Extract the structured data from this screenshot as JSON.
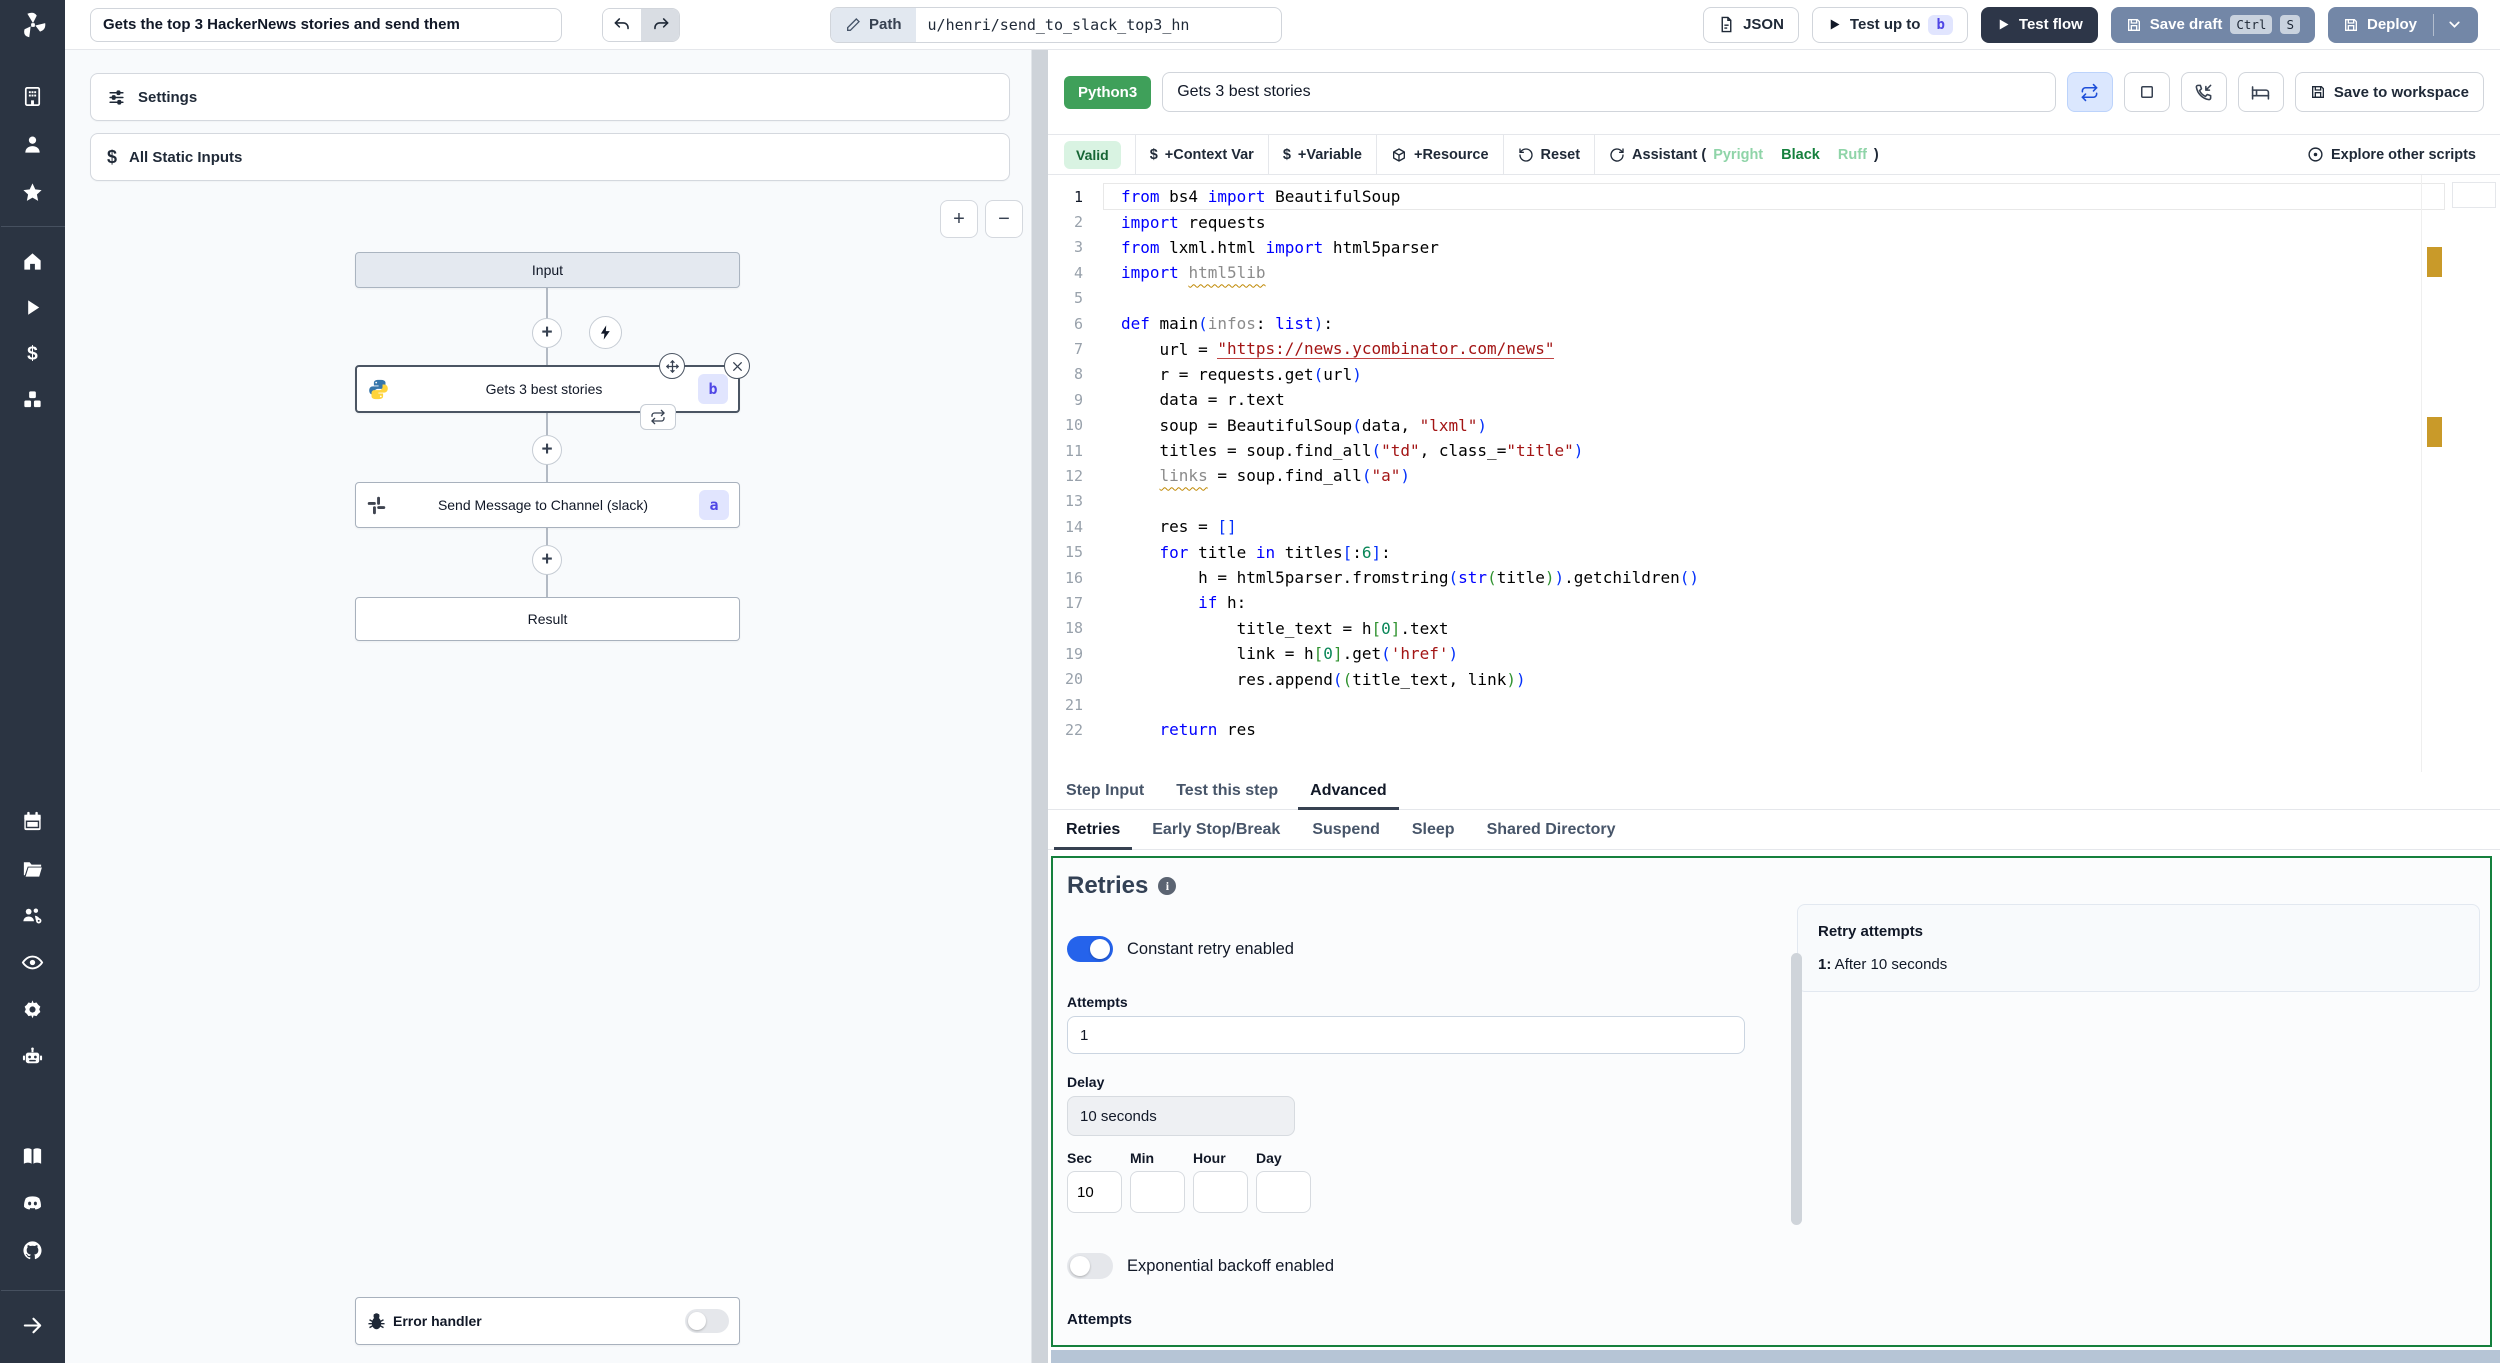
{
  "topbar": {
    "flow_title": "Gets the top 3 HackerNews stories and send them",
    "path_label": "Path",
    "path_value": "u/henri/send_to_slack_top3_hn",
    "json_button": "JSON",
    "test_up_to": "Test up to",
    "test_up_to_badge": "b",
    "test_flow": "Test flow",
    "save_draft": "Save draft",
    "kbd_ctrl": "Ctrl",
    "kbd_s": "S",
    "deploy": "Deploy"
  },
  "sidebar": {
    "icons": [
      "windmill-logo",
      "workspace-building",
      "user",
      "favorites-star",
      "home",
      "runs-play",
      "variables-dollar",
      "resources-cubes",
      "schedules-calendar",
      "folders",
      "groups-users",
      "audit-eye",
      "settings-gear",
      "workers-robot",
      "docs-book",
      "discord",
      "github",
      "expand-arrow"
    ]
  },
  "flow_panel": {
    "settings_label": "Settings",
    "static_inputs_label": "All Static Inputs",
    "zoom_in": "+",
    "zoom_out": "−",
    "nodes": {
      "input": "Input",
      "step_b_label": "Gets 3 best stories",
      "step_b_badge": "b",
      "step_a_label": "Send Message to Channel (slack)",
      "step_a_badge": "a",
      "result": "Result"
    },
    "error_handler_label": "Error handler"
  },
  "editor": {
    "language_badge": "Python3",
    "step_name": "Gets 3 best stories",
    "save_to_workspace": "Save to workspace",
    "toolbar": {
      "valid": "Valid",
      "context_var": "+Context Var",
      "variable": "+Variable",
      "resource": "+Resource",
      "reset": "Reset",
      "assistant_prefix": "Assistant (",
      "assistant_pyright": "Pyright",
      "assistant_black": "Black",
      "assistant_ruff": "Ruff",
      "assistant_suffix": ")",
      "explore": "Explore other scripts"
    },
    "code_lines": [
      [
        [
          "from",
          "k"
        ],
        [
          " bs4 ",
          "d"
        ],
        [
          "import",
          "k"
        ],
        [
          " BeautifulSoup",
          "d"
        ]
      ],
      [
        [
          "import",
          "k"
        ],
        [
          " requests",
          "d"
        ]
      ],
      [
        [
          "from",
          "k"
        ],
        [
          " lxml.html ",
          "d"
        ],
        [
          "import",
          "k"
        ],
        [
          " html5parser",
          "d"
        ]
      ],
      [
        [
          "import",
          "k"
        ],
        [
          " ",
          "d"
        ],
        [
          "html5lib",
          "gsq"
        ]
      ],
      [],
      [
        [
          "def",
          "k"
        ],
        [
          " main",
          "d"
        ],
        [
          "(",
          "pb"
        ],
        [
          "infos",
          "g"
        ],
        [
          ": ",
          "d"
        ],
        [
          "list",
          "k"
        ],
        [
          ")",
          "pb"
        ],
        [
          ":",
          "d"
        ]
      ],
      [
        [
          "    url = ",
          "d"
        ],
        [
          "\"https://news.ycombinator.com/news\"",
          "lnk"
        ]
      ],
      [
        [
          "    r = requests.get",
          "d"
        ],
        [
          "(",
          "pb"
        ],
        [
          "url",
          "d"
        ],
        [
          ")",
          "pb"
        ]
      ],
      [
        [
          "    data = r.text",
          "d"
        ]
      ],
      [
        [
          "    soup = BeautifulSoup",
          "d"
        ],
        [
          "(",
          "pb"
        ],
        [
          "data, ",
          "d"
        ],
        [
          "\"lxml\"",
          "s"
        ],
        [
          ")",
          "pb"
        ]
      ],
      [
        [
          "    titles = soup.find_all",
          "d"
        ],
        [
          "(",
          "pb"
        ],
        [
          "\"td\"",
          "s"
        ],
        [
          ", class_=",
          "d"
        ],
        [
          "\"title\"",
          "s"
        ],
        [
          ")",
          "pb"
        ]
      ],
      [
        [
          "    ",
          "d"
        ],
        [
          "links",
          "gsq"
        ],
        [
          " = soup.find_all",
          "d"
        ],
        [
          "(",
          "pb"
        ],
        [
          "\"a\"",
          "s"
        ],
        [
          ")",
          "pb"
        ]
      ],
      [],
      [
        [
          "    res = ",
          "d"
        ],
        [
          "[]",
          "pb"
        ]
      ],
      [
        [
          "    for",
          "k"
        ],
        [
          " title ",
          "d"
        ],
        [
          "in",
          "k"
        ],
        [
          " titles",
          "d"
        ],
        [
          "[",
          "pb"
        ],
        [
          ":",
          "d"
        ],
        [
          "6",
          "n"
        ],
        [
          "]",
          "pb"
        ],
        [
          ":",
          "d"
        ]
      ],
      [
        [
          "        h = html5parser.fromstring",
          "d"
        ],
        [
          "(",
          "pb"
        ],
        [
          "str",
          "k"
        ],
        [
          "(",
          "pg"
        ],
        [
          "title",
          "d"
        ],
        [
          ")",
          "pg"
        ],
        [
          ")",
          "pb"
        ],
        [
          ".getchildren",
          "d"
        ],
        [
          "()",
          "pb"
        ]
      ],
      [
        [
          "        if",
          "k"
        ],
        [
          " h:",
          "d"
        ]
      ],
      [
        [
          "            title_text = h",
          "d"
        ],
        [
          "[",
          "pg"
        ],
        [
          "0",
          "n"
        ],
        [
          "]",
          "pg"
        ],
        [
          ".text",
          "d"
        ]
      ],
      [
        [
          "            link = h",
          "d"
        ],
        [
          "[",
          "pg"
        ],
        [
          "0",
          "n"
        ],
        [
          "]",
          "pg"
        ],
        [
          ".get",
          "d"
        ],
        [
          "(",
          "pb"
        ],
        [
          "'href'",
          "s"
        ],
        [
          ")",
          "pb"
        ]
      ],
      [
        [
          "            res.append",
          "d"
        ],
        [
          "(",
          "pb"
        ],
        [
          "(",
          "pg"
        ],
        [
          "title_text, link",
          "d"
        ],
        [
          ")",
          "pg"
        ],
        [
          ")",
          "pb"
        ]
      ],
      [],
      [
        [
          "    return",
          "k"
        ],
        [
          " res",
          "d"
        ]
      ]
    ]
  },
  "tabs": {
    "main": [
      "Step Input",
      "Test this step",
      "Advanced"
    ],
    "active_main": "Advanced",
    "sub": [
      "Retries",
      "Early Stop/Break",
      "Suspend",
      "Sleep",
      "Shared Directory"
    ],
    "active_sub": "Retries"
  },
  "retries": {
    "heading": "Retries",
    "constant_toggle_label": "Constant retry enabled",
    "attempts_label": "Attempts",
    "attempts_value": "1",
    "delay_label": "Delay",
    "delay_value": "10 seconds",
    "time_fields": [
      {
        "label": "Sec",
        "value": "10"
      },
      {
        "label": "Min",
        "value": ""
      },
      {
        "label": "Hour",
        "value": ""
      },
      {
        "label": "Day",
        "value": ""
      }
    ],
    "backoff_toggle_label": "Exponential backoff enabled",
    "attempts2_label": "Attempts",
    "summary": {
      "title": "Retry attempts",
      "line_prefix": "1:",
      "line_text": " After 10 seconds"
    }
  },
  "colors": {
    "sidebar_navy": "#2b3442",
    "dark_button_navy": "#2d3648",
    "slate_button_blue": "#7387a7",
    "python_badge_green": "#3fa05a",
    "valid_green": "#166534",
    "retries_border_green": "#15803d",
    "toggle_blue": "#2563eb",
    "step_badge_indigo": "#4f46e5",
    "warning_orange": "#bf8803"
  }
}
